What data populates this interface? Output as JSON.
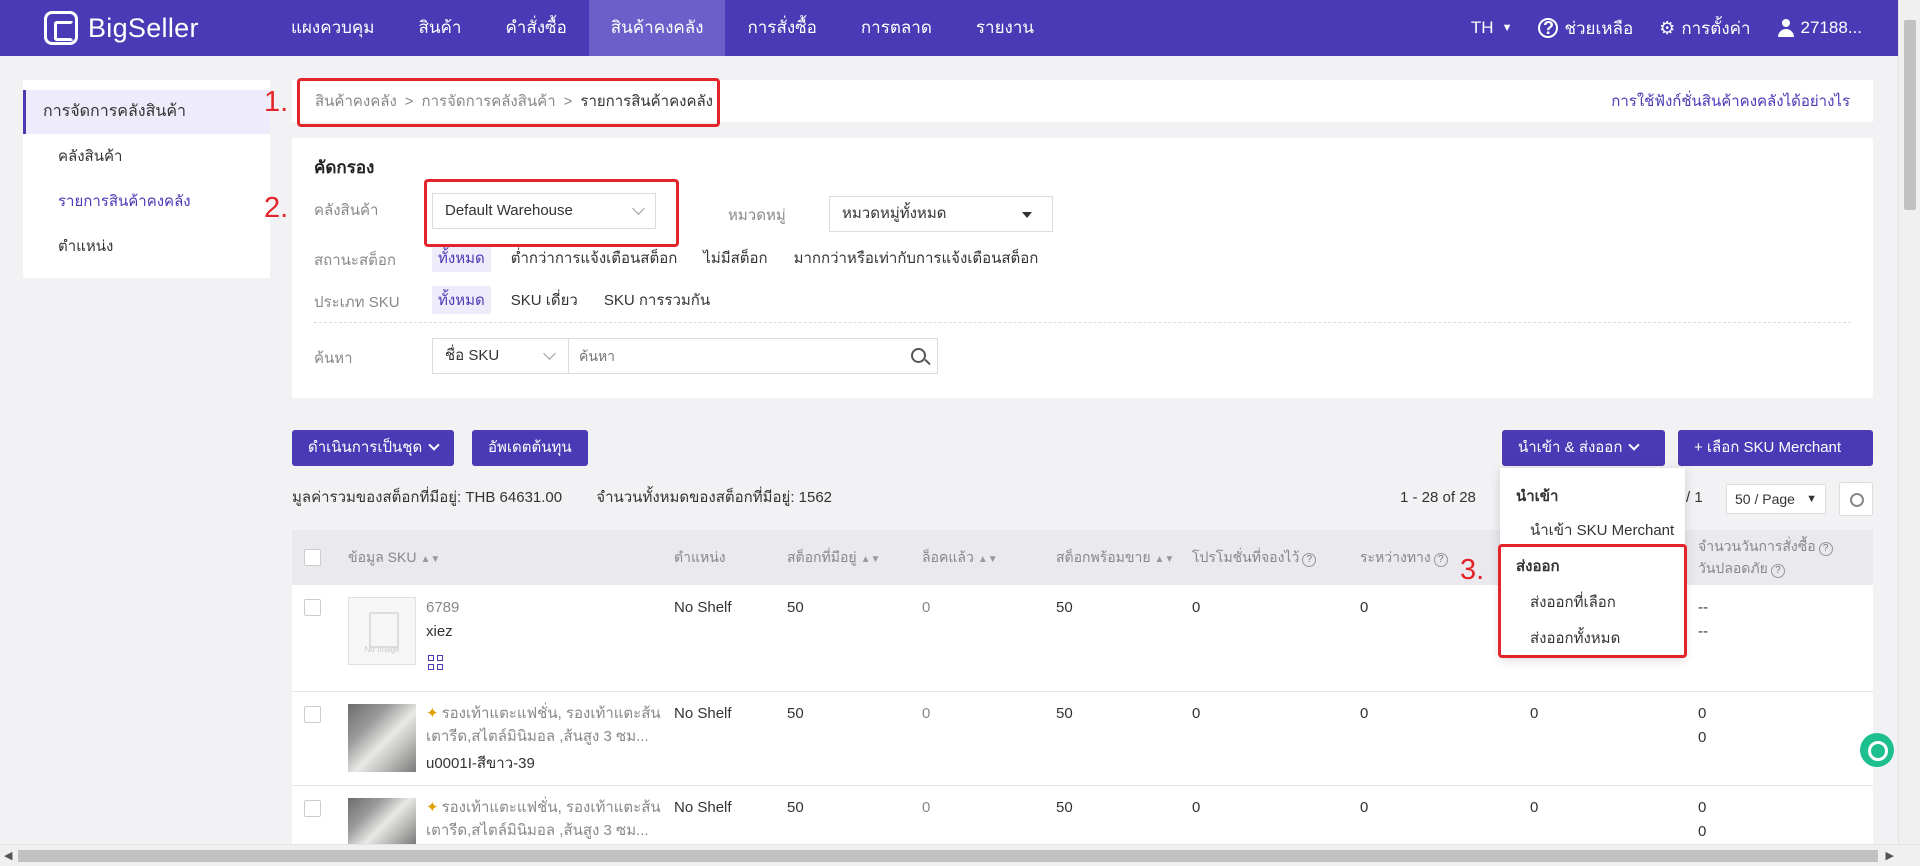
{
  "brand": {
    "name": "BigSeller"
  },
  "nav": {
    "items": [
      "แผงควบคุม",
      "สินค้า",
      "คำสั่งซื้อ",
      "สินค้าคงคลัง",
      "การสั่งซื้อ",
      "การตลาด",
      "รายงาน"
    ],
    "active_index": 3
  },
  "topright": {
    "lang": "TH",
    "help": "ช่วยเหลือ",
    "settings": "การตั้งค่า",
    "user": "27188..."
  },
  "sidebar": {
    "header": "การจัดการคลังสินค้า",
    "items": [
      "คลังสินค้า",
      "รายการสินค้าคงคลัง",
      "ตำแหน่ง"
    ],
    "active_index": 1
  },
  "breadcrumb": {
    "items": [
      "สินค้าคงคลัง",
      "การจัดการคลังสินค้า",
      "รายการสินค้าคงคลัง"
    ],
    "help_link": "การใช้ฟังก์ชั่นสินค้าคงคลังได้อย่างไร"
  },
  "filter": {
    "title": "คัดกรอง",
    "warehouse_label": "คลังสินค้า",
    "warehouse_value": "Default Warehouse",
    "category_label": "หมวดหมู่",
    "category_value": "หมวดหมู่ทั้งหมด",
    "stock_status_label": "สถานะสต็อก",
    "stock_status_options": [
      "ทั้งหมด",
      "ต่ำกว่าการแจ้งเตือนสต็อก",
      "ไม่มีสต็อก",
      "มากกว่าหรือเท่ากับการแจ้งเตือนสต็อก"
    ],
    "sku_type_label": "ประเภท SKU",
    "sku_type_options": [
      "ทั้งหมด",
      "SKU เดี่ยว",
      "SKU การรวมกัน"
    ],
    "search_label": "ค้นหา",
    "search_field": "ชื่อ SKU",
    "search_placeholder": "ค้นหา"
  },
  "annotations": [
    "1.",
    "2.",
    "3."
  ],
  "actions": {
    "batch": "ดำเนินการเป็นชุด",
    "update_cost": "อัพเดตต้นทุน",
    "import_export": "นำเข้า & ส่งออก",
    "select_merchant": "+ เลือก SKU Merchant"
  },
  "summary": {
    "total_value": "มูลค่ารวมของสต็อกที่มีอยู่: THB 64631.00",
    "total_qty": "จำนวนทั้งหมดของสต็อกที่มีอยู่: 1562"
  },
  "pager": {
    "range": "1 - 28 of 28",
    "page_total": "/ 1",
    "per_page": "50 / Page"
  },
  "dropdown": {
    "import_header": "นำเข้า",
    "import_item": "นำเข้า SKU Merchant",
    "export_header": "ส่งออก",
    "export_selected": "ส่งออกที่เลือก",
    "export_all": "ส่งออกทั้งหมด"
  },
  "table": {
    "headers": {
      "sku_info": "ข้อมูล SKU",
      "location": "ตำแหน่ง",
      "available": "สต็อกที่มีอยู่",
      "locked": "ล็อคแล้ว",
      "sellable": "สต็อกพร้อมขาย",
      "promo_reserved": "โปรโมชั่นที่จองไว้",
      "in_transit": "ระหว่างทาง",
      "days_order": "จำนวนวันการสั่งซื้อ",
      "safe_days": "วันปลอดภัย"
    },
    "rows": [
      {
        "sku": "6789",
        "name": "xiez",
        "location": "No Shelf",
        "available": "50",
        "locked": "0",
        "sellable": "50",
        "promo": "0",
        "transit": "0",
        "extra": "",
        "days1": "--",
        "days2": "--"
      },
      {
        "title": "รองเท้าแตะแฟชั่น, รองเท้าแตะส้นเตารีด,สไตล์มินิมอล ,ส้นสูง 3 ซม...",
        "sku": "u0001I-สีขาว-39",
        "location": "No Shelf",
        "available": "50",
        "locked": "0",
        "sellable": "50",
        "promo": "0",
        "transit": "0",
        "extra": "0",
        "days1": "0",
        "days2": "0"
      },
      {
        "title": "รองเท้าแตะแฟชั่น, รองเท้าแตะส้นเตารีด,สไตล์มินิมอล ,ส้นสูง 3 ซม...",
        "location": "No Shelf",
        "available": "50",
        "locked": "0",
        "sellable": "50",
        "promo": "0",
        "transit": "0",
        "extra": "0",
        "days1": "0",
        "days2": "0"
      }
    ],
    "no_image_text": "No Image"
  },
  "colors": {
    "primary": "#4a3ab5",
    "annotation": "#e3242b",
    "chat": "#1dbf8e"
  }
}
